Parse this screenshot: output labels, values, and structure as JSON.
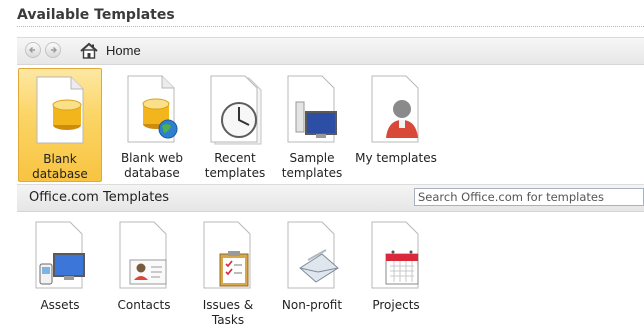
{
  "header": {
    "title": "Available Templates"
  },
  "nav": {
    "back_icon": "arrow-left-icon",
    "forward_icon": "arrow-right-icon",
    "home_icon": "home-icon",
    "home_label": "Home"
  },
  "templates": [
    {
      "label": "Blank\ndatabase",
      "icon": "blank-database-icon",
      "selected": true
    },
    {
      "label": "Blank web\ndatabase",
      "icon": "blank-web-database-icon"
    },
    {
      "label": "Recent\ntemplates",
      "icon": "clock-icon"
    },
    {
      "label": "Sample\ntemplates",
      "icon": "monitor-icon"
    },
    {
      "label": "My templates",
      "icon": "user-icon"
    }
  ],
  "office": {
    "section_label": "Office.com Templates",
    "search_placeholder": "Search Office.com for templates",
    "categories": [
      {
        "label": "Assets",
        "icon": "assets-icon"
      },
      {
        "label": "Contacts",
        "icon": "contacts-icon"
      },
      {
        "label": "Issues &\nTasks",
        "icon": "clipboard-icon"
      },
      {
        "label": "Non-profit",
        "icon": "envelope-icon"
      },
      {
        "label": "Projects",
        "icon": "calendar-icon"
      }
    ]
  },
  "colors": {
    "selected_bg": "#fbd567",
    "database_gold": "#f2b51c"
  }
}
